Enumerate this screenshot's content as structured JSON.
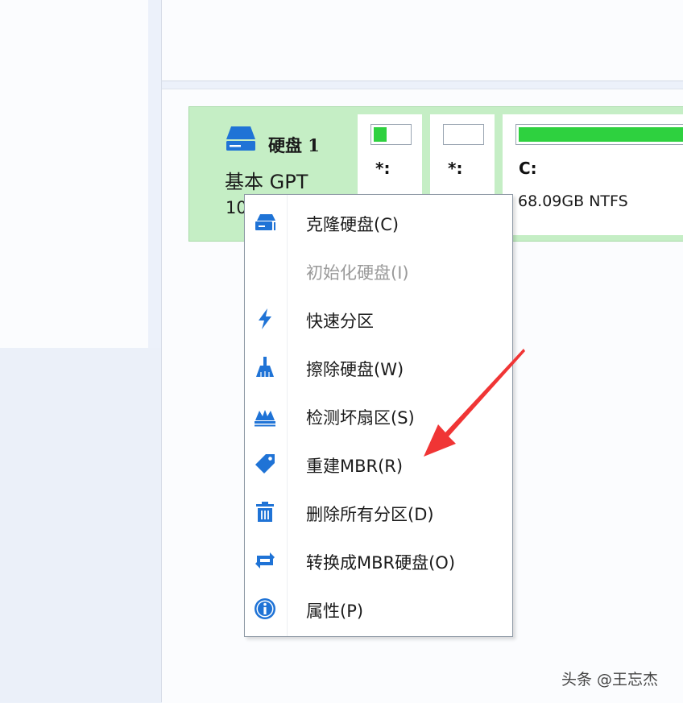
{
  "disk": {
    "name": "硬盘 1",
    "type": "基本 GPT",
    "size_partial": "10"
  },
  "partitions": [
    {
      "label": "*:",
      "usage_percent": 38
    },
    {
      "label": "*:",
      "usage_percent": 0
    },
    {
      "label": "C:",
      "info": "68.09GB NTFS",
      "usage_percent": 100
    }
  ],
  "context_menu": {
    "items": [
      {
        "label": "克隆硬盘(C)",
        "icon": "clone-disk-icon",
        "enabled": true
      },
      {
        "label": "初始化硬盘(I)",
        "icon": "",
        "enabled": false
      },
      {
        "label": "快速分区",
        "icon": "lightning-icon",
        "enabled": true
      },
      {
        "label": "擦除硬盘(W)",
        "icon": "broom-icon",
        "enabled": true
      },
      {
        "label": "检测坏扇区(S)",
        "icon": "sector-scan-icon",
        "enabled": true
      },
      {
        "label": "重建MBR(R)",
        "icon": "tag-icon",
        "enabled": true
      },
      {
        "label": "删除所有分区(D)",
        "icon": "trash-icon",
        "enabled": true
      },
      {
        "label": "转换成MBR硬盘(O)",
        "icon": "convert-icon",
        "enabled": true
      },
      {
        "label": "属性(P)",
        "icon": "info-icon",
        "enabled": true
      }
    ]
  },
  "watermark": "头条 @王忘杰",
  "colors": {
    "accent_blue": "#1f73d6",
    "partition_green": "#2ed13f",
    "disk_row_bg": "#c5eec5",
    "annotation_red": "#f03535"
  }
}
